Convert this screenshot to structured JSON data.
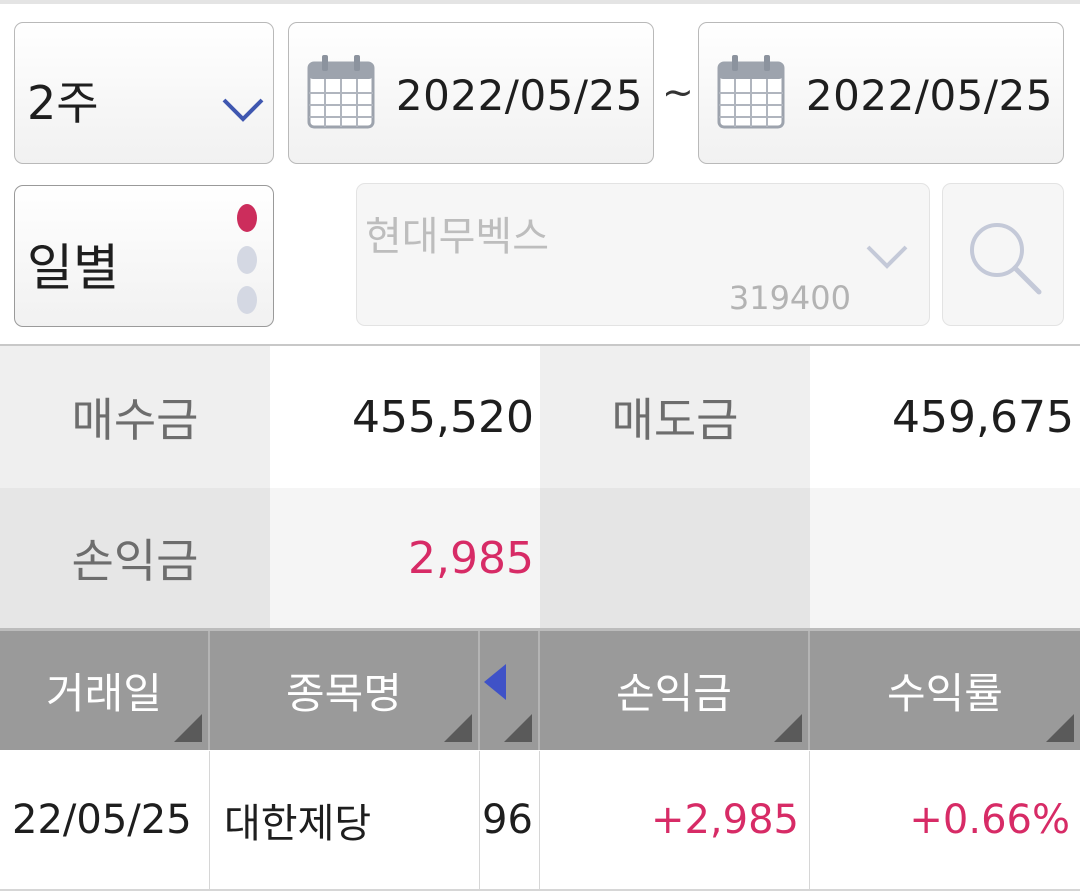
{
  "filters": {
    "period": {
      "label": "2주",
      "icon": "chevron-down-icon"
    },
    "date_from": {
      "value": "2022/05/25",
      "icon": "calendar-icon"
    },
    "separator": "~",
    "date_to": {
      "value": "2022/05/25",
      "icon": "calendar-icon"
    },
    "view_mode": {
      "label": "일별",
      "active_dot_color": "#cc2d5c"
    },
    "stock": {
      "name": "현대무벡스",
      "code": "319400",
      "icon": "chevron-down-icon"
    },
    "search_icon": "search-icon"
  },
  "summary": {
    "buy_label": "매수금",
    "buy_value": "455,520",
    "sell_label": "매도금",
    "sell_value": "459,675",
    "profit_label": "손익금",
    "profit_value": "2,985"
  },
  "table": {
    "columns": [
      "거래일",
      "종목명",
      "",
      "손익금",
      "수익률"
    ],
    "rows": [
      {
        "date": "22/05/25",
        "name": "대한제당",
        "extra": "96",
        "profit": "+2,985",
        "rate": "+0.66%"
      }
    ]
  },
  "colors": {
    "accent_pink": "#d72b66",
    "header_gray": "#9a9a9a",
    "arrow_blue": "#3f52c7"
  }
}
